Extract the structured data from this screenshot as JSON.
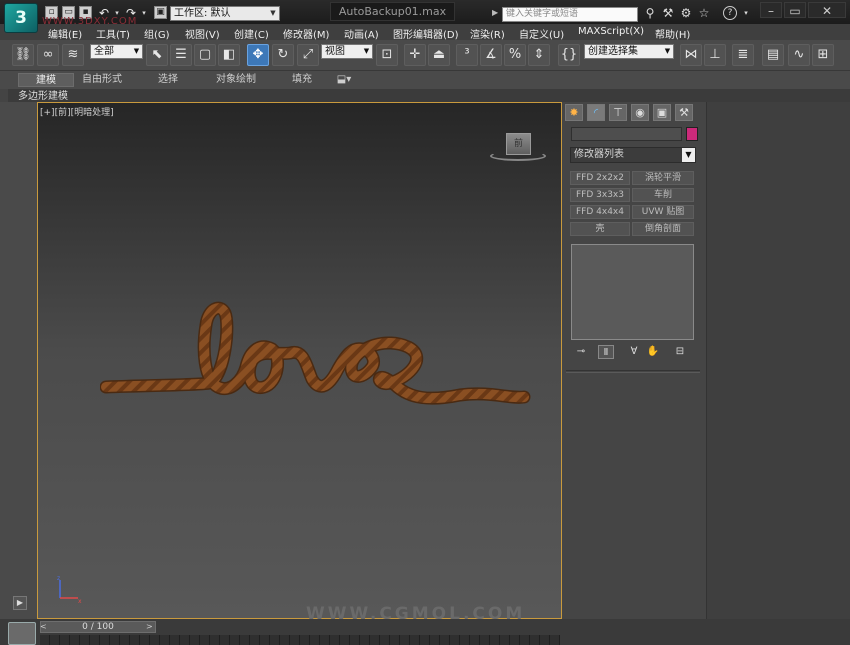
{
  "title_bar": {
    "logo": "3",
    "workspace_label": "工作区: 默认",
    "document_title": "AutoBackup01.max",
    "search_placeholder": "键入关键字或短语",
    "help_label": "?"
  },
  "watermark_top": "WWW.3DXY.COM",
  "menu_items": [
    "编辑(E)",
    "工具(T)",
    "组(G)",
    "视图(V)",
    "创建(C)",
    "修改器(M)",
    "动画(A)",
    "图形编辑器(D)",
    "渲染(R)",
    "自定义(U)",
    "MAXScript(X)",
    "帮助(H)"
  ],
  "toolbar": {
    "selection_filter": "全部",
    "reference_coord": "视图",
    "named_selection": "创建选择集"
  },
  "ribbon": {
    "tabs": [
      "建模",
      "自由形式",
      "选择",
      "对象绘制",
      "填充"
    ],
    "active_tab": "建模",
    "panel_label": "多边形建模"
  },
  "viewport": {
    "label": "[+][前][明暗处理]",
    "viewcube_label": "前",
    "watermark_bottom": "WWW.CGMOL.COM",
    "scene_text": "love"
  },
  "command_panel": {
    "modifier_list": "修改器列表",
    "modifier_buttons": [
      [
        "FFD 2x2x2",
        "涡轮平滑"
      ],
      [
        "FFD 3x3x3",
        "车削"
      ],
      [
        "FFD 4x4x4",
        "UVW 贴图"
      ],
      [
        "壳",
        "倒角剖面"
      ]
    ],
    "object_color": "#cc2a7a"
  },
  "timeline": {
    "frame_counter": "0 / 100"
  },
  "colors": {
    "viewport_border": "#c99a3d",
    "rope": "#8a4f22",
    "active_tool": "#3d78b8"
  }
}
